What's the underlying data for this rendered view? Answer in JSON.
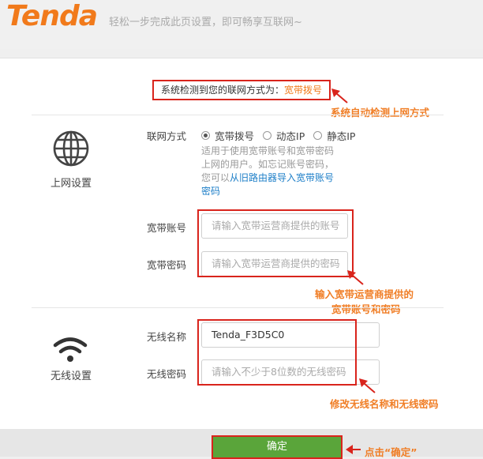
{
  "header": {
    "logo": "Tenda",
    "tagline": "轻松一步完成此页设置，即可畅享互联网~"
  },
  "detect": {
    "prefix": "系统检测到您的联网方式为：",
    "method": "宽带拨号"
  },
  "internet": {
    "section_label": "上网设置",
    "mode_label": "联网方式",
    "options": [
      "宽带拨号",
      "动态IP",
      "静态IP"
    ],
    "selected": "宽带拨号",
    "hint_lines": [
      "适用于使用宽带账号和宽带密码",
      "上网的用户。如忘记账号密码，",
      "您可以"
    ],
    "hint_link_1": "从旧路由器导入宽带账号",
    "hint_link_2": "密码",
    "account_label": "宽带账号",
    "account_placeholder": "请输入宽带运营商提供的账号",
    "password_label": "宽带密码",
    "password_placeholder": "请输入宽带运营商提供的密码"
  },
  "wireless": {
    "section_label": "无线设置",
    "ssid_label": "无线名称",
    "ssid_value": "Tenda_F3D5C0",
    "password_label": "无线密码",
    "password_placeholder": "请输入不少于8位数的无线密码"
  },
  "confirm_label": "确定",
  "annotations": {
    "detect": "系统自动检测上网方式",
    "account_line1": "输入宽带运营商提供的",
    "account_line2": "宽带账号和密码",
    "wireless": "修改无线名称和无线密码",
    "confirm": "点击“确定”"
  },
  "colors": {
    "brand": "#f17a1b",
    "annotation": "#f07e26",
    "highlight": "#d9241c",
    "button": "#5aa53a",
    "link": "#1e7fc8"
  },
  "icons": {
    "internet": "globe-icon",
    "wireless": "wifi-icon"
  }
}
